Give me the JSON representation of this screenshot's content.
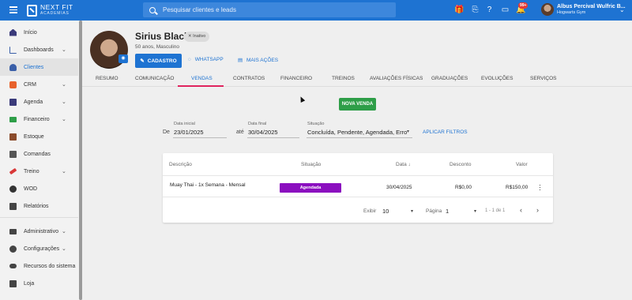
{
  "topbar": {
    "logo_line1": "NEXT FIT",
    "logo_line2": "ACADEMIAS",
    "search_placeholder": "Pesquisar clientes e leads",
    "notification_count": "99+",
    "user_name": "Albus Percival Wulfric B...",
    "user_gym": "Hogwarts Gym"
  },
  "sidebar": {
    "items": [
      {
        "label": "Início",
        "icon": "home-icon",
        "color": "#3a3a7a"
      },
      {
        "label": "Dashboards",
        "icon": "dashboard-icon",
        "color": "#3a5fa8",
        "chevron": "⌄"
      },
      {
        "label": "Clientes",
        "icon": "clients-icon",
        "color": "#3a5fa8"
      },
      {
        "label": "CRM",
        "icon": "crm-icon",
        "color": "#e8622c",
        "chevron": "⌄"
      },
      {
        "label": "Agenda",
        "icon": "calendar-icon",
        "color": "#3a3a7a",
        "chevron": "⌄"
      },
      {
        "label": "Financeiro",
        "icon": "money-icon",
        "color": "#2e9e48",
        "chevron": "⌄"
      },
      {
        "label": "Estoque",
        "icon": "cart-icon",
        "color": "#8b4b2b"
      },
      {
        "label": "Comandas",
        "icon": "receipt-icon",
        "color": "#555555"
      },
      {
        "label": "Treino",
        "icon": "dumbbell-icon",
        "color": "#d93838",
        "chevron": "⌄"
      },
      {
        "label": "WOD",
        "icon": "kettlebell-icon",
        "color": "#333333"
      },
      {
        "label": "Relatórios",
        "icon": "reports-icon",
        "color": "#444444"
      },
      {
        "label": "Administrativo",
        "icon": "admin-icon",
        "color": "#444444",
        "chevron": "⌄"
      },
      {
        "label": "Configurações",
        "icon": "gear-icon",
        "color": "#444444",
        "chevron": "⌄"
      },
      {
        "label": "Recursos do sistema",
        "icon": "toggle-icon",
        "color": "#444444"
      },
      {
        "label": "Loja",
        "icon": "store-icon",
        "color": "#444444"
      }
    ]
  },
  "profile": {
    "name": "Sirius Black",
    "status": "Inativo",
    "subtitle": "50 anos, Masculino",
    "btn_cadastro": "CADASTRO",
    "btn_whatsapp": "WHATSAPP",
    "btn_mais": "MAIS AÇÕES"
  },
  "tabs": [
    "RESUMO",
    "COMUNICAÇÃO",
    "VENDAS",
    "CONTRATOS",
    "FINANCEIRO",
    "TREINOS",
    "AVALIAÇÕES FÍSICAS",
    "GRADUAÇÕES",
    "EVOLUÇÕES",
    "SERVIÇOS"
  ],
  "actions": {
    "nova_venda": "NOVA VENDA"
  },
  "filters": {
    "de_label": "De",
    "data_inicial_label": "Data inicial",
    "data_inicial": "23/01/2025",
    "ate_label": "até",
    "data_final_label": "Data final",
    "data_final": "30/04/2025",
    "situacao_label": "Situação",
    "situacao": "Concluída, Pendente, Agendada, Erro",
    "apply": "APLICAR FILTROS"
  },
  "table": {
    "headers": {
      "descricao": "Descrição",
      "situacao": "Situação",
      "data": "Data",
      "desconto": "Desconto",
      "valor": "Valor"
    },
    "rows": [
      {
        "descricao": "Muay Thai - 1x Semana - Mensal",
        "situacao": "Agendada",
        "data": "30/04/2025",
        "desconto": "R$0,00",
        "valor": "R$150,00"
      }
    ],
    "status_color": "#8b0fbf"
  },
  "pagination": {
    "exibir_label": "Exibir",
    "exibir_value": "10",
    "pagina_label": "Página",
    "pagina_value": "1",
    "range": "1 - 1 de 1"
  }
}
